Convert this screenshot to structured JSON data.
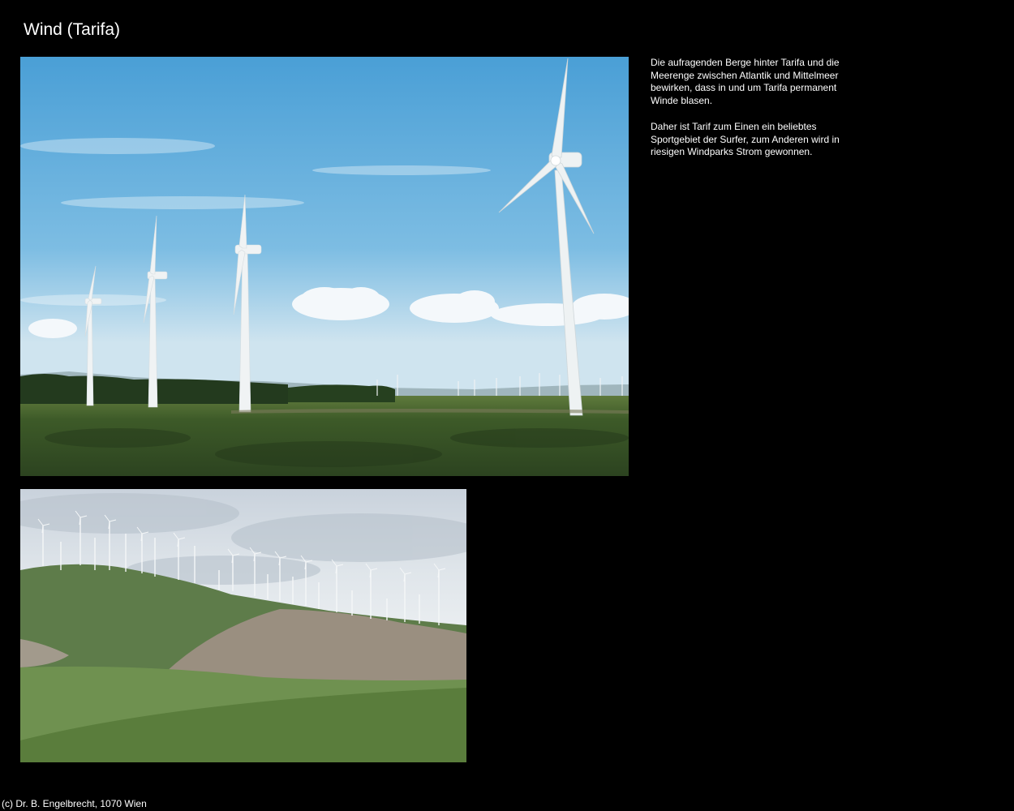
{
  "page": {
    "title": "Wind (Tarifa)",
    "footer": "(c) Dr. B. Engelbrecht, 1070 Wien"
  },
  "description": {
    "paragraph1": "Die aufragenden Berge hinter Tarifa und die Meerenge zwischen Atlantik und Mittelmeer bewirken, dass in und um Tarifa permanent Winde blasen.",
    "paragraph2": "Daher ist Tarif zum Einen ein beliebtes Sportgebiet der Surfer, zum Anderen wird in riesigen Windparks Strom gewonnen."
  },
  "photos": {
    "photo1_subject": "wind turbines in a green field under a blue sky",
    "photo2_subject": "row of wind turbines on a hill ridge"
  },
  "colors": {
    "background": "#000000",
    "text": "#ffffff",
    "sky_blue": "#5aa6d6",
    "grass_green": "#3f5a2a"
  }
}
